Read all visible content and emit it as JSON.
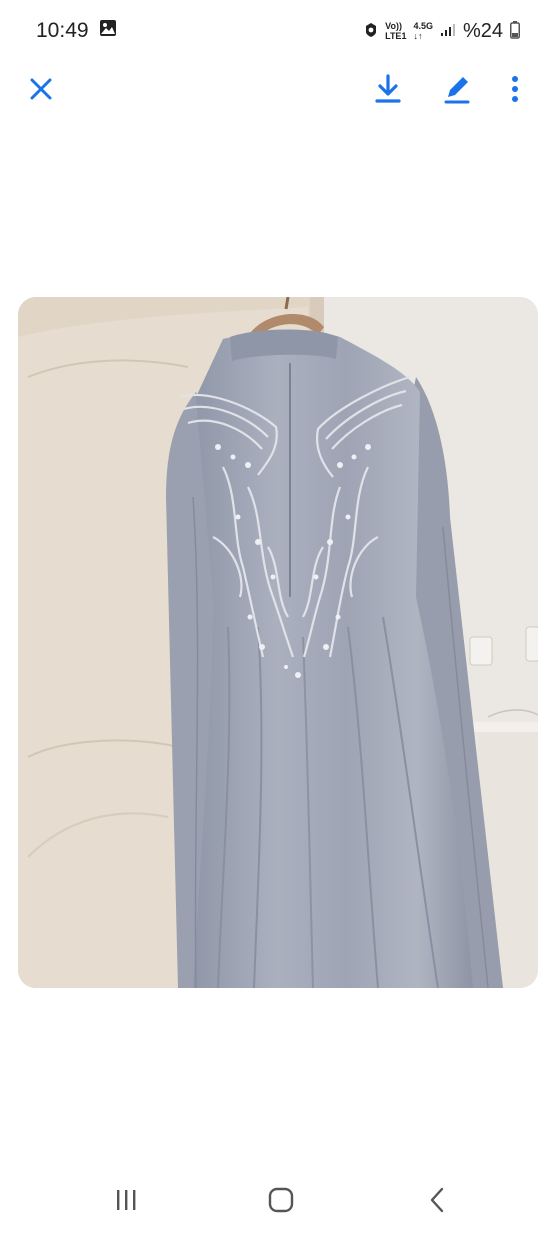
{
  "status_bar": {
    "time": "10:49",
    "network_top": "Vo))",
    "network_bottom": "LTE1",
    "speed_top": "4.5G",
    "speed_bottom": "↓↑",
    "battery": "%24"
  },
  "toolbar": {
    "close_icon": "close-icon",
    "download_icon": "download-icon",
    "edit_icon": "edit-icon",
    "more_icon": "more-vert-icon"
  },
  "image": {
    "subject": "photo"
  },
  "colors": {
    "accent": "#1a73e8",
    "wall": "#e6ddd2",
    "dress": "#a3a9b8"
  }
}
